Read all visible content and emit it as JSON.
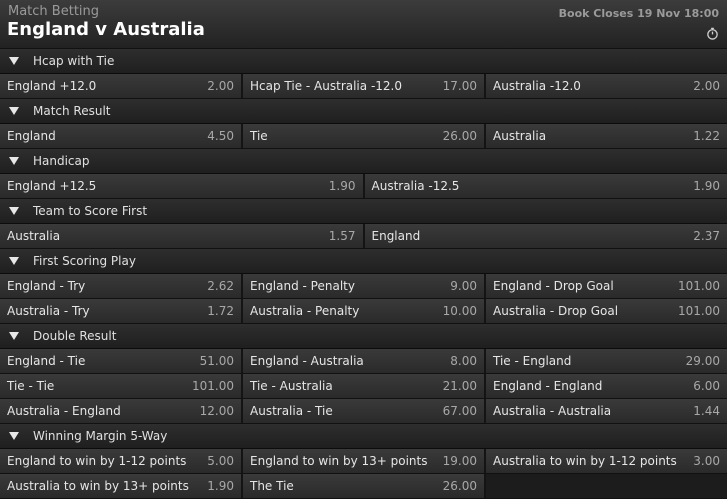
{
  "header": {
    "subtitle": "Match Betting",
    "title": "England v Australia",
    "book_closes": "Book Closes 19 Nov 18:00",
    "timer_icon": "stopwatch-icon"
  },
  "markets": [
    {
      "title": "Hcap with Tie",
      "rows": [
        [
          {
            "name": "England +12.0",
            "odds": "2.00"
          },
          {
            "name": "Hcap Tie - Australia -12.0",
            "odds": "17.00"
          },
          {
            "name": "Australia -12.0",
            "odds": "2.00"
          }
        ]
      ]
    },
    {
      "title": "Match Result",
      "rows": [
        [
          {
            "name": "England",
            "odds": "4.50"
          },
          {
            "name": "Tie",
            "odds": "26.00"
          },
          {
            "name": "Australia",
            "odds": "1.22"
          }
        ]
      ]
    },
    {
      "title": "Handicap",
      "rows": [
        [
          {
            "name": "England +12.5",
            "odds": "1.90"
          },
          {
            "name": "Australia -12.5",
            "odds": "1.90"
          }
        ]
      ]
    },
    {
      "title": "Team to Score First",
      "rows": [
        [
          {
            "name": "Australia",
            "odds": "1.57"
          },
          {
            "name": "England",
            "odds": "2.37"
          }
        ]
      ]
    },
    {
      "title": "First Scoring Play",
      "rows": [
        [
          {
            "name": "England - Try",
            "odds": "2.62"
          },
          {
            "name": "England - Penalty",
            "odds": "9.00"
          },
          {
            "name": "England - Drop Goal",
            "odds": "101.00"
          }
        ],
        [
          {
            "name": "Australia - Try",
            "odds": "1.72"
          },
          {
            "name": "Australia - Penalty",
            "odds": "10.00"
          },
          {
            "name": "Australia - Drop Goal",
            "odds": "101.00"
          }
        ]
      ]
    },
    {
      "title": "Double Result",
      "rows": [
        [
          {
            "name": "England - Tie",
            "odds": "51.00"
          },
          {
            "name": "England - Australia",
            "odds": "8.00"
          },
          {
            "name": "Tie - England",
            "odds": "29.00"
          }
        ],
        [
          {
            "name": "Tie - Tie",
            "odds": "101.00"
          },
          {
            "name": "Tie - Australia",
            "odds": "21.00"
          },
          {
            "name": "England - England",
            "odds": "6.00"
          }
        ],
        [
          {
            "name": "Australia - England",
            "odds": "12.00"
          },
          {
            "name": "Australia - Tie",
            "odds": "67.00"
          },
          {
            "name": "Australia - Australia",
            "odds": "1.44"
          }
        ]
      ]
    },
    {
      "title": "Winning Margin 5-Way",
      "rows": [
        [
          {
            "name": "England to win by 1-12 points",
            "odds": "5.00"
          },
          {
            "name": "England to win by 13+ points",
            "odds": "19.00"
          },
          {
            "name": "Australia to win by 1-12 points",
            "odds": "3.00"
          }
        ],
        [
          {
            "name": "Australia to win by 13+ points",
            "odds": "1.90"
          },
          {
            "name": "The Tie",
            "odds": "26.00"
          },
          {
            "name": "",
            "odds": ""
          }
        ]
      ]
    }
  ]
}
